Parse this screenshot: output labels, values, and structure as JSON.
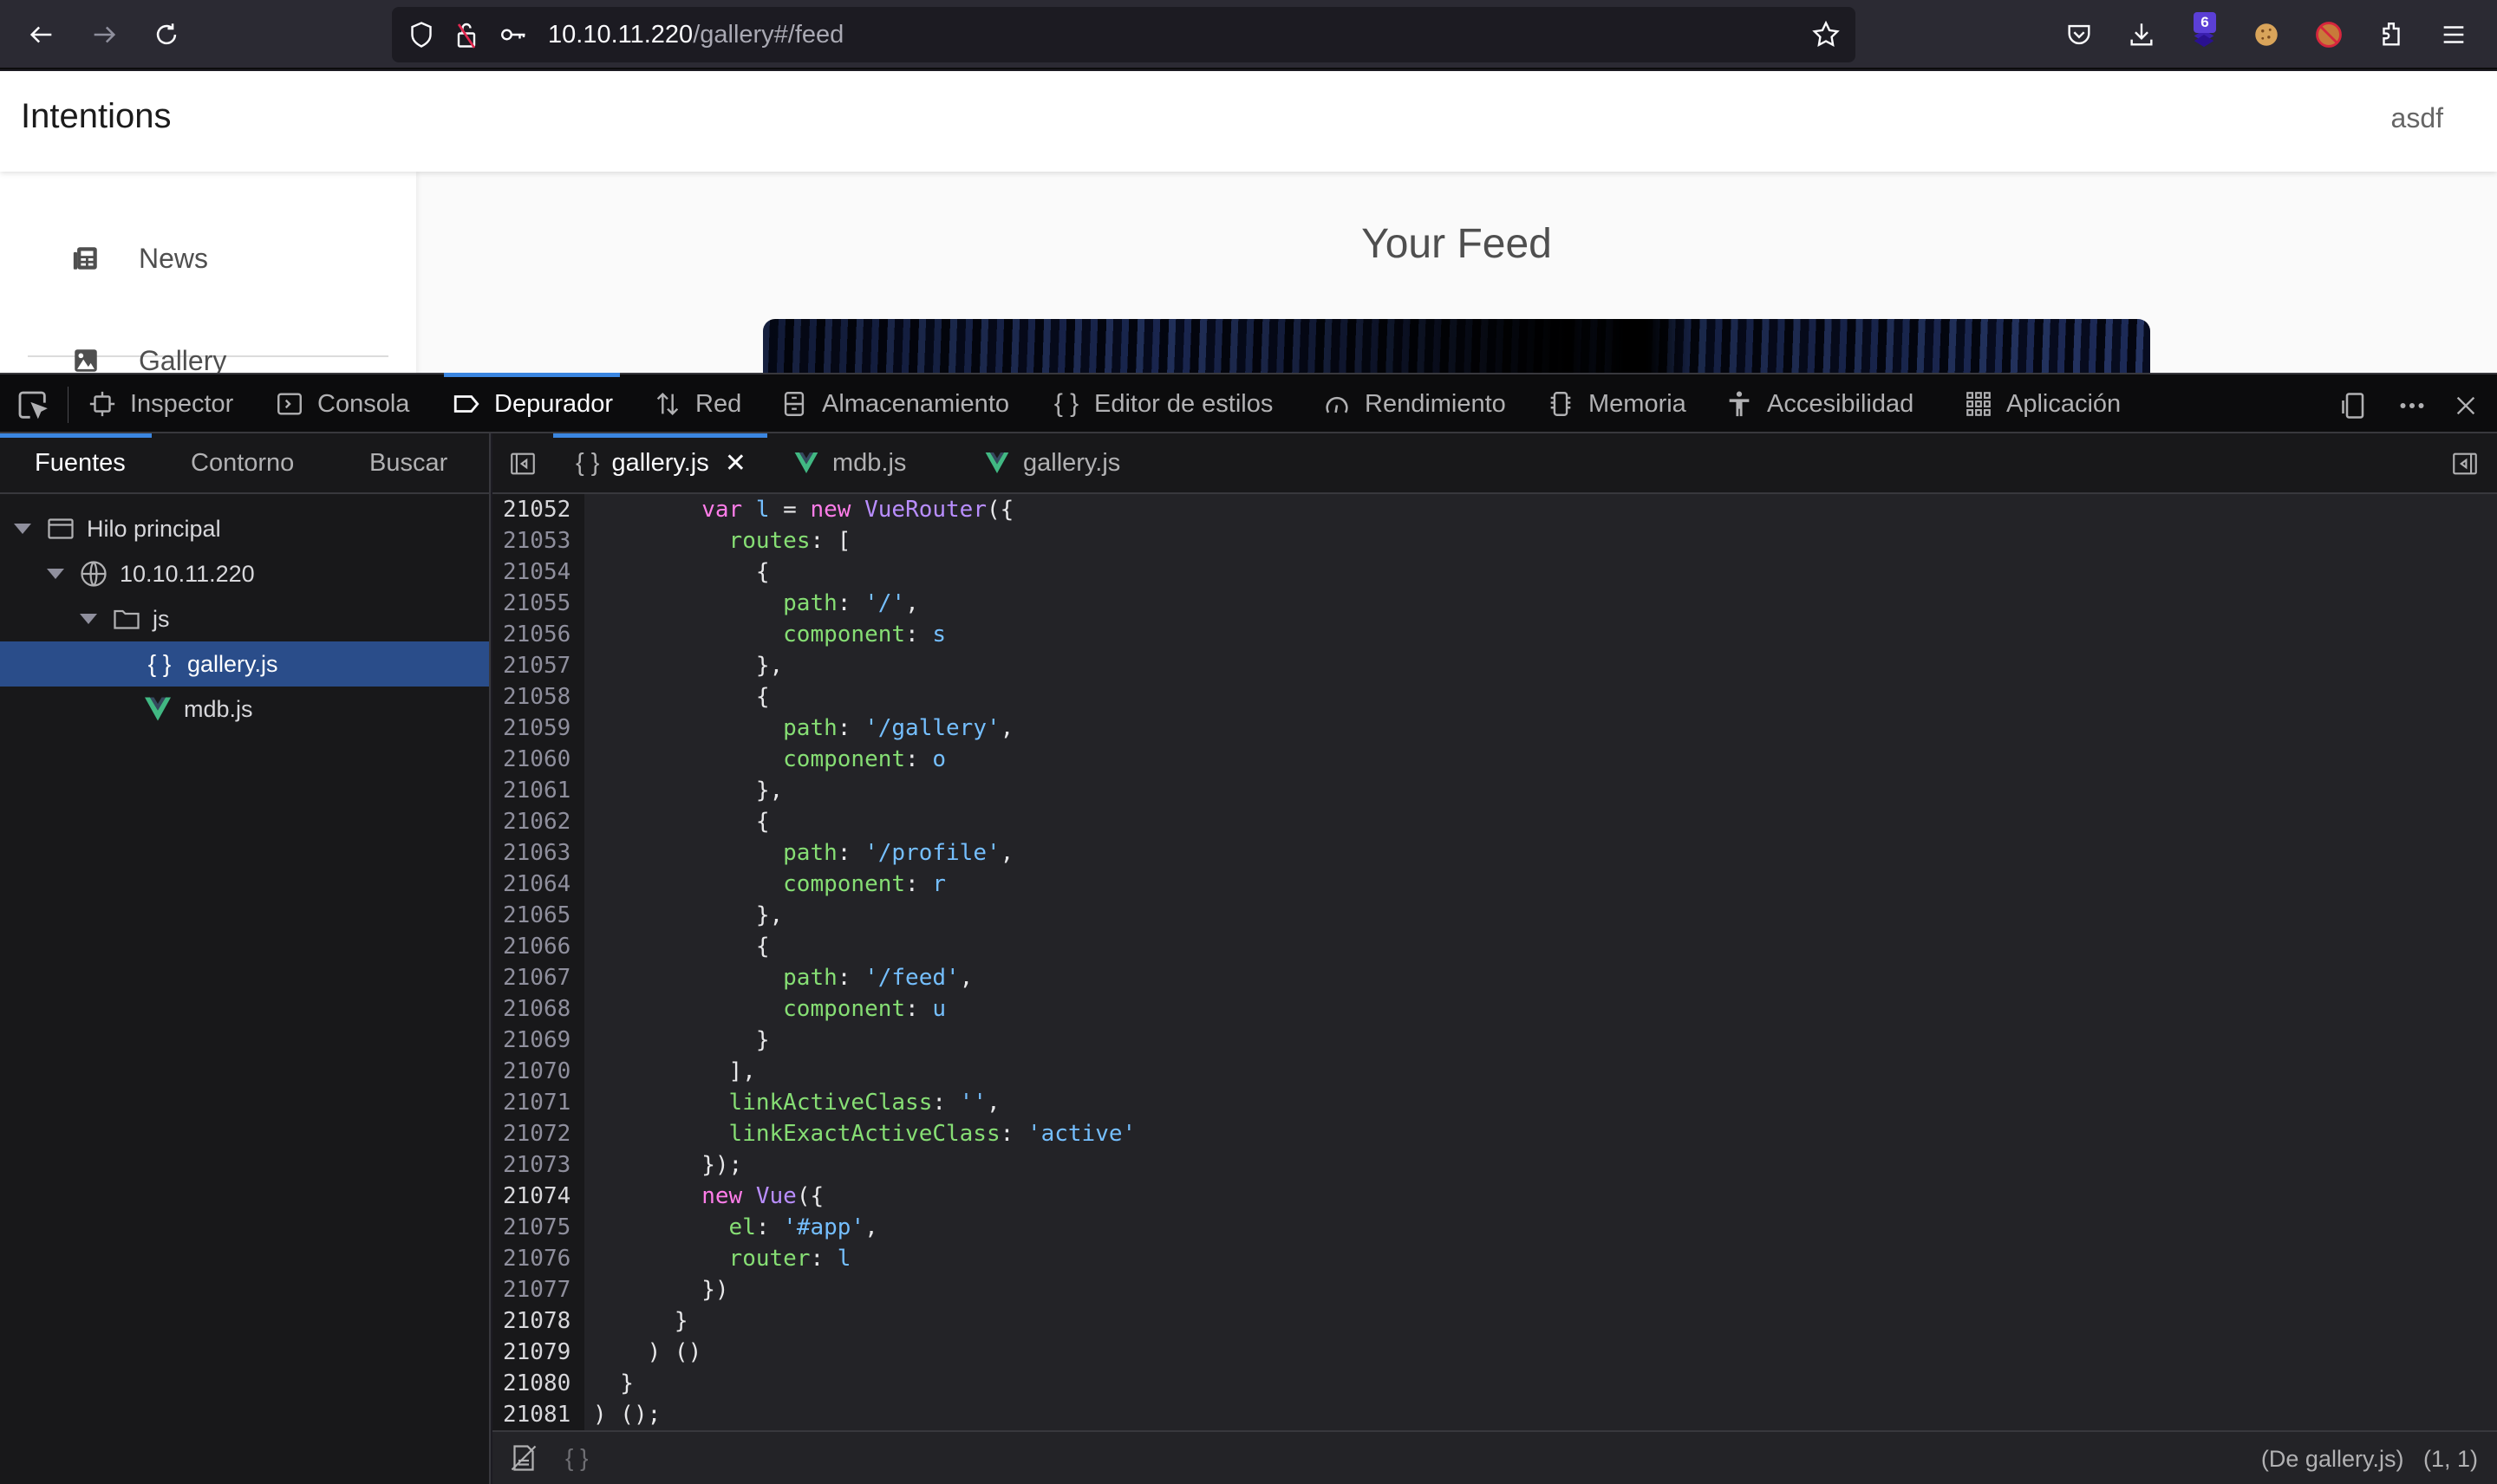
{
  "browser": {
    "url_host": "10.10.11.220",
    "url_path": "/gallery#/feed",
    "extension_badge": "6",
    "icons": [
      "back-icon",
      "forward-icon",
      "reload-icon",
      "shield-icon",
      "insecure-lock-icon",
      "key-icon",
      "bookmark-star-icon",
      "pocket-icon",
      "downloads-icon",
      "extension-layers-icon",
      "cookie-icon",
      "blocked-fox-icon",
      "extensions-puzzle-icon",
      "menu-icon"
    ]
  },
  "site": {
    "brand": "Intentions",
    "user": "asdf",
    "nav": [
      {
        "label": "News",
        "icon": "newspaper-icon"
      },
      {
        "label": "Gallery",
        "icon": "image-icon"
      }
    ],
    "feed_title": "Your Feed"
  },
  "devtools": {
    "tabs": [
      {
        "label": "Inspector",
        "icon": "inspector-icon"
      },
      {
        "label": "Consola",
        "icon": "console-icon"
      },
      {
        "label": "Depurador",
        "icon": "debugger-icon",
        "active": true
      },
      {
        "label": "Red",
        "icon": "network-icon"
      },
      {
        "label": "Almacenamiento",
        "icon": "storage-icon"
      },
      {
        "label": "Editor de estilos",
        "icon": "style-editor-icon"
      },
      {
        "label": "Rendimiento",
        "icon": "performance-icon"
      },
      {
        "label": "Memoria",
        "icon": "memory-icon"
      },
      {
        "label": "Accesibilidad",
        "icon": "accessibility-icon"
      },
      {
        "label": "Aplicación",
        "icon": "application-icon"
      }
    ],
    "sources_tabs": [
      {
        "label": "Fuentes",
        "active": true
      },
      {
        "label": "Contorno"
      },
      {
        "label": "Buscar"
      }
    ],
    "tree": [
      {
        "label": "Hilo principal",
        "icon": "window-icon",
        "expanded": true
      },
      {
        "label": "10.10.11.220",
        "icon": "globe-icon",
        "expanded": true
      },
      {
        "label": "js",
        "icon": "folder-icon",
        "expanded": true
      },
      {
        "label": "gallery.js",
        "icon": "braces-icon",
        "selected": true
      },
      {
        "label": "mdb.js",
        "icon": "vue-icon"
      }
    ],
    "editor_tabs": [
      {
        "label": "gallery.js",
        "icon": "braces-icon",
        "active": true,
        "closable": true
      },
      {
        "label": "mdb.js",
        "icon": "vue-icon"
      },
      {
        "label": "gallery.js",
        "icon": "vue-icon"
      }
    ],
    "code_lines": [
      {
        "n": "21052",
        "bright": true,
        "tokens": [
          [
            "",
            "        "
          ],
          [
            "kw",
            "var"
          ],
          [
            "",
            " "
          ],
          [
            "id",
            "l"
          ],
          [
            "",
            " = "
          ],
          [
            "kw",
            "new"
          ],
          [
            "",
            " "
          ],
          [
            "cls",
            "VueRouter"
          ],
          [
            "",
            "({"
          ]
        ]
      },
      {
        "n": "21053",
        "bright": false,
        "tokens": [
          [
            "",
            "          "
          ],
          [
            "prop",
            "routes"
          ],
          [
            "",
            ": ["
          ]
        ]
      },
      {
        "n": "21054",
        "bright": false,
        "tokens": [
          [
            "",
            "            {"
          ]
        ]
      },
      {
        "n": "21055",
        "bright": false,
        "tokens": [
          [
            "",
            "              "
          ],
          [
            "prop",
            "path"
          ],
          [
            "",
            ": "
          ],
          [
            "str",
            "'/'"
          ],
          [
            "",
            ","
          ]
        ]
      },
      {
        "n": "21056",
        "bright": false,
        "tokens": [
          [
            "",
            "              "
          ],
          [
            "prop",
            "component"
          ],
          [
            "",
            ": "
          ],
          [
            "id",
            "s"
          ]
        ]
      },
      {
        "n": "21057",
        "bright": false,
        "tokens": [
          [
            "",
            "            },"
          ]
        ]
      },
      {
        "n": "21058",
        "bright": false,
        "tokens": [
          [
            "",
            "            {"
          ]
        ]
      },
      {
        "n": "21059",
        "bright": false,
        "tokens": [
          [
            "",
            "              "
          ],
          [
            "prop",
            "path"
          ],
          [
            "",
            ": "
          ],
          [
            "str",
            "'/gallery'"
          ],
          [
            "",
            ","
          ]
        ]
      },
      {
        "n": "21060",
        "bright": false,
        "tokens": [
          [
            "",
            "              "
          ],
          [
            "prop",
            "component"
          ],
          [
            "",
            ": "
          ],
          [
            "id",
            "o"
          ]
        ]
      },
      {
        "n": "21061",
        "bright": false,
        "tokens": [
          [
            "",
            "            },"
          ]
        ]
      },
      {
        "n": "21062",
        "bright": false,
        "tokens": [
          [
            "",
            "            {"
          ]
        ]
      },
      {
        "n": "21063",
        "bright": false,
        "tokens": [
          [
            "",
            "              "
          ],
          [
            "prop",
            "path"
          ],
          [
            "",
            ": "
          ],
          [
            "str",
            "'/profile'"
          ],
          [
            "",
            ","
          ]
        ]
      },
      {
        "n": "21064",
        "bright": false,
        "tokens": [
          [
            "",
            "              "
          ],
          [
            "prop",
            "component"
          ],
          [
            "",
            ": "
          ],
          [
            "id",
            "r"
          ]
        ]
      },
      {
        "n": "21065",
        "bright": false,
        "tokens": [
          [
            "",
            "            },"
          ]
        ]
      },
      {
        "n": "21066",
        "bright": false,
        "tokens": [
          [
            "",
            "            {"
          ]
        ]
      },
      {
        "n": "21067",
        "bright": false,
        "tokens": [
          [
            "",
            "              "
          ],
          [
            "prop",
            "path"
          ],
          [
            "",
            ": "
          ],
          [
            "str",
            "'/feed'"
          ],
          [
            "",
            ","
          ]
        ]
      },
      {
        "n": "21068",
        "bright": false,
        "tokens": [
          [
            "",
            "              "
          ],
          [
            "prop",
            "component"
          ],
          [
            "",
            ": "
          ],
          [
            "id",
            "u"
          ]
        ]
      },
      {
        "n": "21069",
        "bright": false,
        "tokens": [
          [
            "",
            "            }"
          ]
        ]
      },
      {
        "n": "21070",
        "bright": false,
        "tokens": [
          [
            "",
            "          ],"
          ]
        ]
      },
      {
        "n": "21071",
        "bright": false,
        "tokens": [
          [
            "",
            "          "
          ],
          [
            "prop",
            "linkActiveClass"
          ],
          [
            "",
            ": "
          ],
          [
            "str",
            "''"
          ],
          [
            "",
            ","
          ]
        ]
      },
      {
        "n": "21072",
        "bright": false,
        "tokens": [
          [
            "",
            "          "
          ],
          [
            "prop",
            "linkExactActiveClass"
          ],
          [
            "",
            ": "
          ],
          [
            "str",
            "'active'"
          ]
        ]
      },
      {
        "n": "21073",
        "bright": false,
        "tokens": [
          [
            "",
            "        });"
          ]
        ]
      },
      {
        "n": "21074",
        "bright": true,
        "tokens": [
          [
            "",
            "        "
          ],
          [
            "kw",
            "new"
          ],
          [
            "",
            " "
          ],
          [
            "cls",
            "Vue"
          ],
          [
            "",
            "({"
          ]
        ]
      },
      {
        "n": "21075",
        "bright": false,
        "tokens": [
          [
            "",
            "          "
          ],
          [
            "prop",
            "el"
          ],
          [
            "",
            ": "
          ],
          [
            "str",
            "'#app'"
          ],
          [
            "",
            ","
          ]
        ]
      },
      {
        "n": "21076",
        "bright": false,
        "tokens": [
          [
            "",
            "          "
          ],
          [
            "prop",
            "router"
          ],
          [
            "",
            ": "
          ],
          [
            "id",
            "l"
          ]
        ]
      },
      {
        "n": "21077",
        "bright": false,
        "tokens": [
          [
            "",
            "        })"
          ]
        ]
      },
      {
        "n": "21078",
        "bright": true,
        "tokens": [
          [
            "",
            "      }"
          ]
        ]
      },
      {
        "n": "21079",
        "bright": true,
        "tokens": [
          [
            "",
            "    ) ()"
          ]
        ]
      },
      {
        "n": "21080",
        "bright": true,
        "tokens": [
          [
            "",
            "  }"
          ]
        ]
      },
      {
        "n": "21081",
        "bright": true,
        "tokens": [
          [
            "",
            ") ();"
          ]
        ]
      }
    ],
    "status": {
      "source_label": "(De gallery.js)",
      "cursor": "(1, 1)"
    }
  }
}
